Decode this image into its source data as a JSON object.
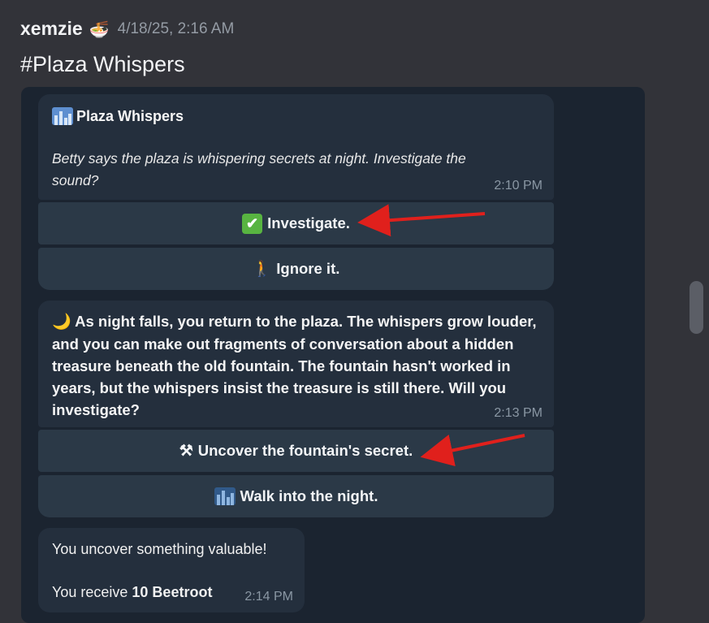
{
  "post": {
    "author": "xemzie",
    "author_badge_icon": "ramen-bowl-icon",
    "timestamp": "4/18/25, 2:16 AM",
    "channel_title": "#Plaza Whispers"
  },
  "messages": [
    {
      "icon": "cityscape-icon",
      "title": "Plaza Whispers",
      "body": "Betty says the plaza is whispering secrets at night. Investigate the sound?",
      "time": "2:10 PM",
      "buttons": [
        {
          "icon": "check-mark-button-icon",
          "emoji": "✔",
          "label": "Investigate."
        },
        {
          "icon": "person-walking-icon",
          "emoji": "🚶",
          "label": "Ignore it."
        }
      ]
    },
    {
      "icon": "crescent-moon-icon",
      "body_emoji": "🌙",
      "body": "As night falls, you return to the plaza. The whispers grow louder, and you can make out fragments of conversation about a hidden treasure beneath the old fountain. The fountain hasn't worked in years, but the whispers insist the treasure is still there. Will you investigate?",
      "time": "2:13 PM",
      "buttons": [
        {
          "icon": "hammer-and-pick-icon",
          "emoji": "⚒",
          "label": "Uncover the fountain's secret."
        },
        {
          "icon": "night-city-icon",
          "emoji": "",
          "label": "Walk into the night."
        }
      ]
    },
    {
      "line1": "You uncover something valuable!",
      "line2_prefix": "You receive ",
      "line2_bold": "10 Beetroot",
      "time": "2:14 PM"
    }
  ],
  "colors": {
    "background": "#323339",
    "panel": "#1b2430",
    "bubble": "#242f3d",
    "button": "#2b3947",
    "arrow": "#e0201c"
  }
}
